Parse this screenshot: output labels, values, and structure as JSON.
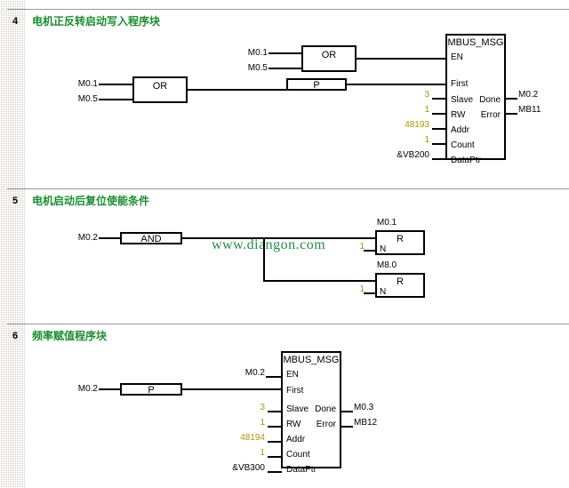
{
  "app": {
    "watermark": "www.diangon.com"
  },
  "networks": [
    {
      "number": "4",
      "title": "电机正反转启动写入程序块",
      "or_top": {
        "label": "OR",
        "in1": "M0.1",
        "in2": "M0.5"
      },
      "or_bottom": {
        "label": "OR",
        "in1": "M0.1",
        "in2": "M0.5"
      },
      "p_contact": {
        "label": "P"
      },
      "mbus": {
        "title": "MBUS_MSG",
        "pins_in": [
          "EN",
          "First",
          "Slave",
          "RW",
          "Addr",
          "Count",
          "DataPtr"
        ],
        "pins_out": [
          "Done",
          "Error"
        ],
        "values_in": {
          "Slave": "3",
          "RW": "1",
          "Addr": "48193",
          "Count": "1",
          "DataPtr": "&VB200"
        },
        "values_out": {
          "Done": "M0.2",
          "Error": "MB11"
        }
      }
    },
    {
      "number": "5",
      "title": "电机启动后复位使能条件",
      "and_block": {
        "label": "AND",
        "in1": "M0.2"
      },
      "resets": [
        {
          "name": "M0.1",
          "label": "R",
          "pin": "N",
          "count": "1"
        },
        {
          "name": "M8.0",
          "label": "R",
          "pin": "N",
          "count": "1"
        }
      ]
    },
    {
      "number": "6",
      "title": "频率赋值程序块",
      "p_contact": {
        "label": "P",
        "in1": "M0.2"
      },
      "mbus": {
        "title": "MBUS_MSG",
        "pins_in": [
          "EN",
          "First",
          "Slave",
          "RW",
          "Addr",
          "Count",
          "DataPtr"
        ],
        "pins_out": [
          "Done",
          "Error"
        ],
        "values_in": {
          "EN": "M0.2",
          "Slave": "3",
          "RW": "1",
          "Addr": "48194",
          "Count": "1",
          "DataPtr": "&VB300"
        },
        "values_out": {
          "Done": "M0.3",
          "Error": "MB12"
        }
      }
    }
  ]
}
